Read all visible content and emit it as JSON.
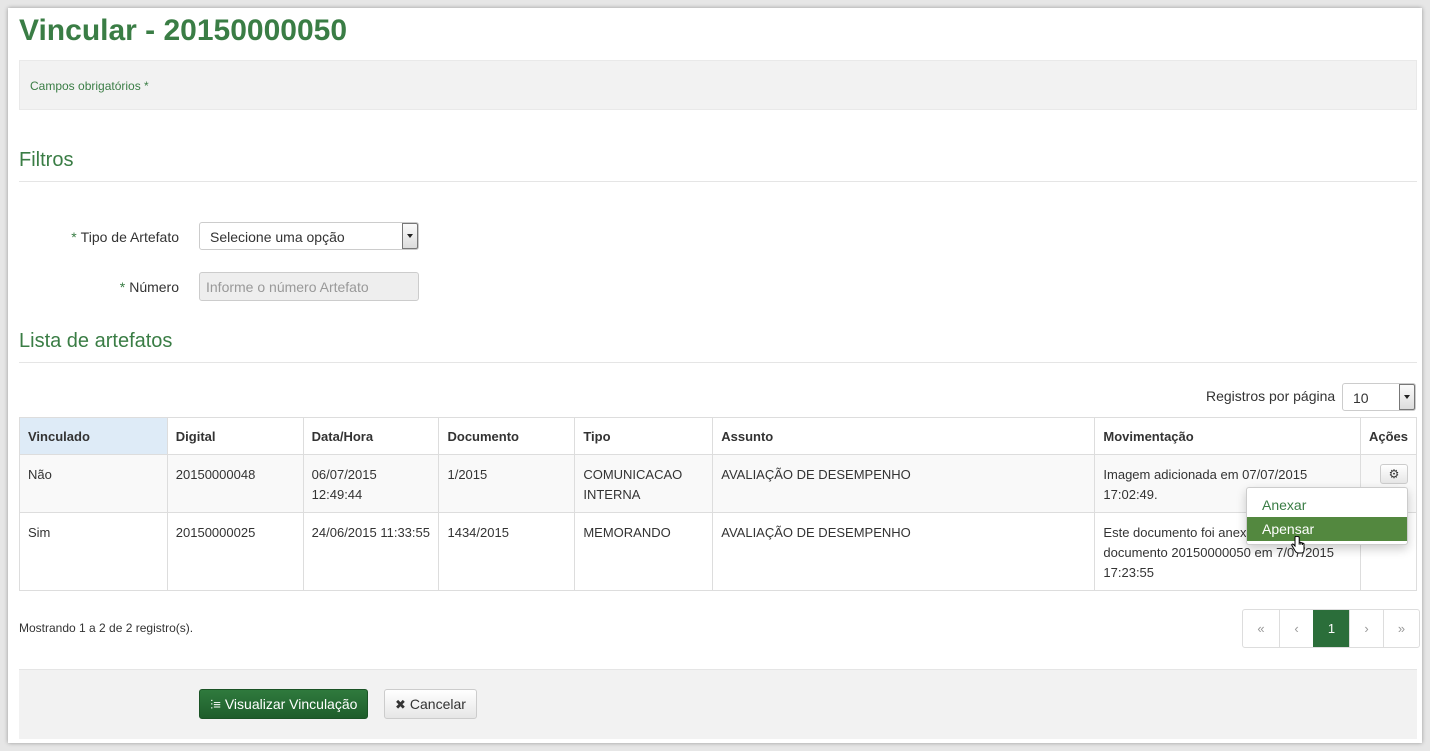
{
  "page": {
    "title": "Vincular - 20150000050",
    "required_note": "Campos obrigatórios *"
  },
  "filters": {
    "section_title": "Filtros",
    "tipo_label": "Tipo de Artefato",
    "tipo_value": "Selecione uma opção",
    "numero_label": "Número",
    "numero_placeholder": "Informe o número Artefato",
    "required_star": "*"
  },
  "list": {
    "section_title": "Lista de artefatos",
    "per_page_label": "Registros por página",
    "per_page_value": "10",
    "columns": [
      "Vinculado",
      "Digital",
      "Data/Hora",
      "Documento",
      "Tipo",
      "Assunto",
      "Movimentação",
      "Ações"
    ],
    "rows": [
      {
        "vinculado": "Não",
        "digital": "20150000048",
        "data_hora": "06/07/2015 12:49:44",
        "documento": "1/2015",
        "tipo": "COMUNICACAO INTERNA",
        "assunto": "AVALIAÇÃO DE DESEMPENHO",
        "movimentacao": "Imagem adicionada em 07/07/2015 17:02:49."
      },
      {
        "vinculado": "Sim",
        "digital": "20150000025",
        "data_hora": "24/06/2015 11:33:55",
        "documento": "1434/2015",
        "tipo": "MEMORANDO",
        "assunto": "AVALIAÇÃO DE DESEMPENHO",
        "movimentacao": "Este documento foi anexado ao documento 20150000050 em 7/07/2015 17:23:55"
      }
    ],
    "actions_menu": {
      "icon": "gear-icon",
      "items": [
        "Anexar",
        "Apensar"
      ],
      "highlighted": "Apensar"
    },
    "showing_text": "Mostrando 1 a 2 de 2 registro(s).",
    "pagination": {
      "first": "«",
      "prev": "‹",
      "current": "1",
      "next": "›",
      "last": "»"
    }
  },
  "footer": {
    "primary_button": "Visualizar Vinculação",
    "cancel_button": "Cancelar",
    "primary_icon": "link-list-icon",
    "cancel_icon": "close-icon"
  },
  "colors": {
    "brand_green": "#3a7d45",
    "menu_highlight": "#53883f",
    "pager_active": "#2b6e3a",
    "header_active": "#deebf7"
  }
}
